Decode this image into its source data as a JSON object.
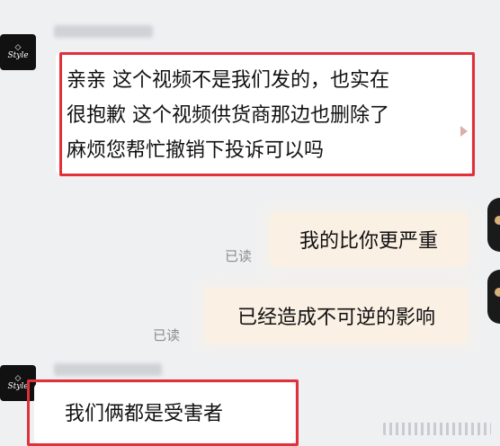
{
  "chat": {
    "avatar_logo_text": "Style",
    "messages": [
      {
        "side": "left",
        "text": "亲亲 这个视频不是我们发的，也实在\n很抱歉 这个视频供货商那边也删除了\n麻烦您帮忙撤销下投诉可以吗"
      },
      {
        "side": "right",
        "text": "我的比你更严重",
        "status": "已读"
      },
      {
        "side": "right",
        "text": "已经造成不可逆的影响",
        "status": "已读"
      },
      {
        "side": "left",
        "text": "我们俩都是受害者"
      }
    ]
  },
  "colors": {
    "background": "#eef0f2",
    "highlight_outline": "#e0303a",
    "right_bubble": "#fbf0e4",
    "left_bubble": "#ffffff",
    "read_status": "#8c8c8c"
  }
}
